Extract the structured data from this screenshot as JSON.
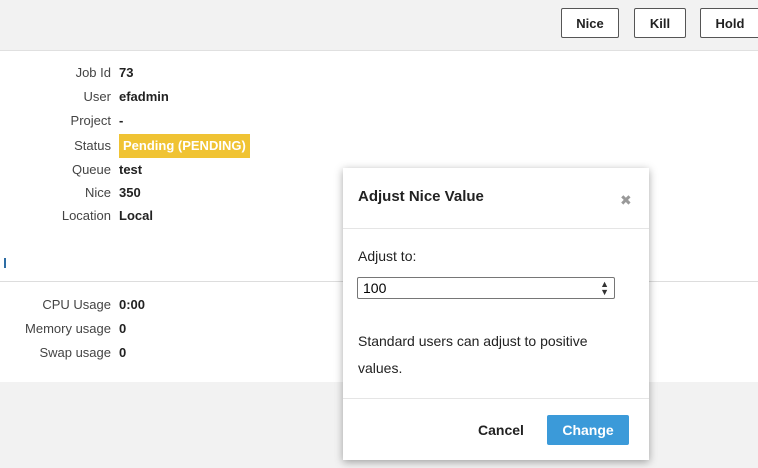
{
  "toolbar": {
    "nice_label": "Nice",
    "kill_label": "Kill",
    "hold_label": "Hold"
  },
  "job_details": [
    {
      "label": "Job Id",
      "value": "73"
    },
    {
      "label": "User",
      "value": "efadmin"
    },
    {
      "label": "Project",
      "value": "-"
    },
    {
      "label": "Status",
      "value": "Pending (PENDING)"
    },
    {
      "label": "Queue",
      "value": "test"
    },
    {
      "label": "Nice",
      "value": "350"
    },
    {
      "label": "Location",
      "value": "Local"
    }
  ],
  "usage": [
    {
      "label": "CPU Usage",
      "value": "0:00"
    },
    {
      "label": "Memory usage",
      "value": "0"
    },
    {
      "label": "Swap usage",
      "value": "0"
    }
  ],
  "colors": {
    "status_badge": "#f0c333",
    "primary_button": "#3b9ad9"
  },
  "modal": {
    "title": "Adjust Nice Value",
    "close_icon": "close-icon",
    "field_label": "Adjust to:",
    "input_value": "100",
    "help_text": "Standard users can adjust to positive values.",
    "cancel_label": "Cancel",
    "change_label": "Change"
  }
}
